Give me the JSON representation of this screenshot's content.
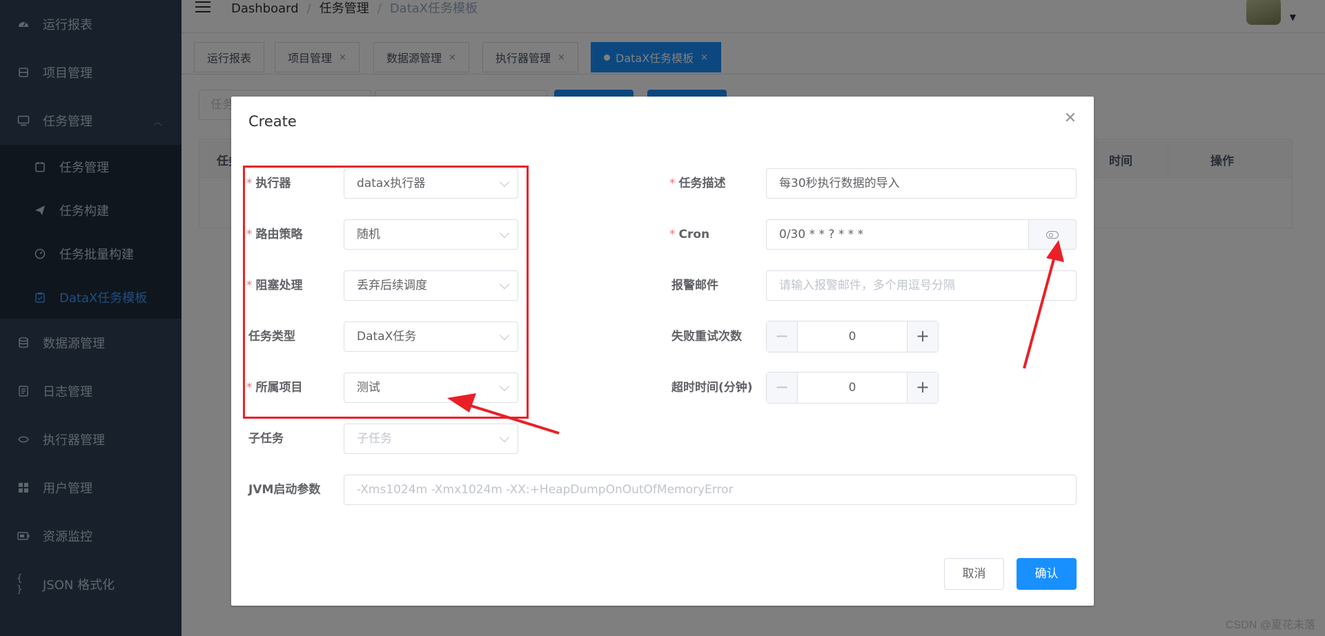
{
  "sidebar": {
    "items": [
      {
        "label": "运行报表",
        "icon": "dashboard-icon"
      },
      {
        "label": "项目管理",
        "icon": "project-icon"
      },
      {
        "label": "任务管理",
        "icon": "monitor-icon"
      },
      {
        "label": "数据源管理",
        "icon": "database-icon"
      },
      {
        "label": "日志管理",
        "icon": "log-icon"
      },
      {
        "label": "执行器管理",
        "icon": "executor-icon"
      },
      {
        "label": "用户管理",
        "icon": "users-grid-icon"
      },
      {
        "label": "资源监控",
        "icon": "battery-icon"
      },
      {
        "label": "JSON 格式化",
        "icon": "braces-icon"
      }
    ],
    "submenu": [
      {
        "label": "任务管理",
        "icon": "calendar-icon"
      },
      {
        "label": "任务构建",
        "icon": "paper-plane-icon"
      },
      {
        "label": "任务批量构建",
        "icon": "dashboard-dial-icon"
      },
      {
        "label": "DataX任务模板",
        "icon": "clipboard-icon",
        "active": true
      }
    ]
  },
  "breadcrumb": {
    "items": [
      "Dashboard",
      "任务管理",
      "DataX任务模板"
    ],
    "separator": "/"
  },
  "tags": [
    {
      "label": "运行报表"
    },
    {
      "label": "项目管理"
    },
    {
      "label": "数据源管理"
    },
    {
      "label": "执行器管理"
    },
    {
      "label": "DataX任务模板",
      "active": true
    }
  ],
  "tag_close": "×",
  "background_table": {
    "head_first": "任务",
    "head_time": "时间",
    "head_ops": "操作",
    "filter_placeholder": "任务"
  },
  "dialog": {
    "title": "Create",
    "close_icon": "close-icon",
    "left_fields": [
      {
        "label": "执行器",
        "required": true,
        "value": "datax执行器"
      },
      {
        "label": "路由策略",
        "required": true,
        "value": "随机"
      },
      {
        "label": "阻塞处理",
        "required": true,
        "value": "丢弃后续调度"
      },
      {
        "label": "任务类型",
        "required": false,
        "value": "DataX任务"
      },
      {
        "label": "所属项目",
        "required": true,
        "value": "测试"
      },
      {
        "label": "子任务",
        "required": false,
        "placeholder": "子任务"
      }
    ],
    "right_fields": {
      "desc": {
        "label": "任务描述",
        "required": true,
        "value": "每30秒执行数据的导入"
      },
      "cron": {
        "label": "Cron",
        "required": true,
        "value": "0/30 * * ? * * *"
      },
      "email": {
        "label": "报警邮件",
        "placeholder": "请输入报警邮件，多个用逗号分隔"
      },
      "retry": {
        "label": "失败重试次数",
        "value": "0"
      },
      "timeout": {
        "label": "超时时间(分钟)",
        "value": "0"
      }
    },
    "jvm": {
      "label": "JVM启动参数",
      "placeholder": "-Xms1024m -Xmx1024m -XX:+HeapDumpOnOutOfMemoryError"
    },
    "cancel_label": "取消",
    "confirm_label": "确认",
    "required_mark": "*",
    "minus": "−",
    "plus": "+"
  },
  "colors": {
    "accent": "#1890ff",
    "annotation": "#ea2027",
    "sidebar_bg": "#304156"
  },
  "watermark": "CSDN @夏花未落"
}
